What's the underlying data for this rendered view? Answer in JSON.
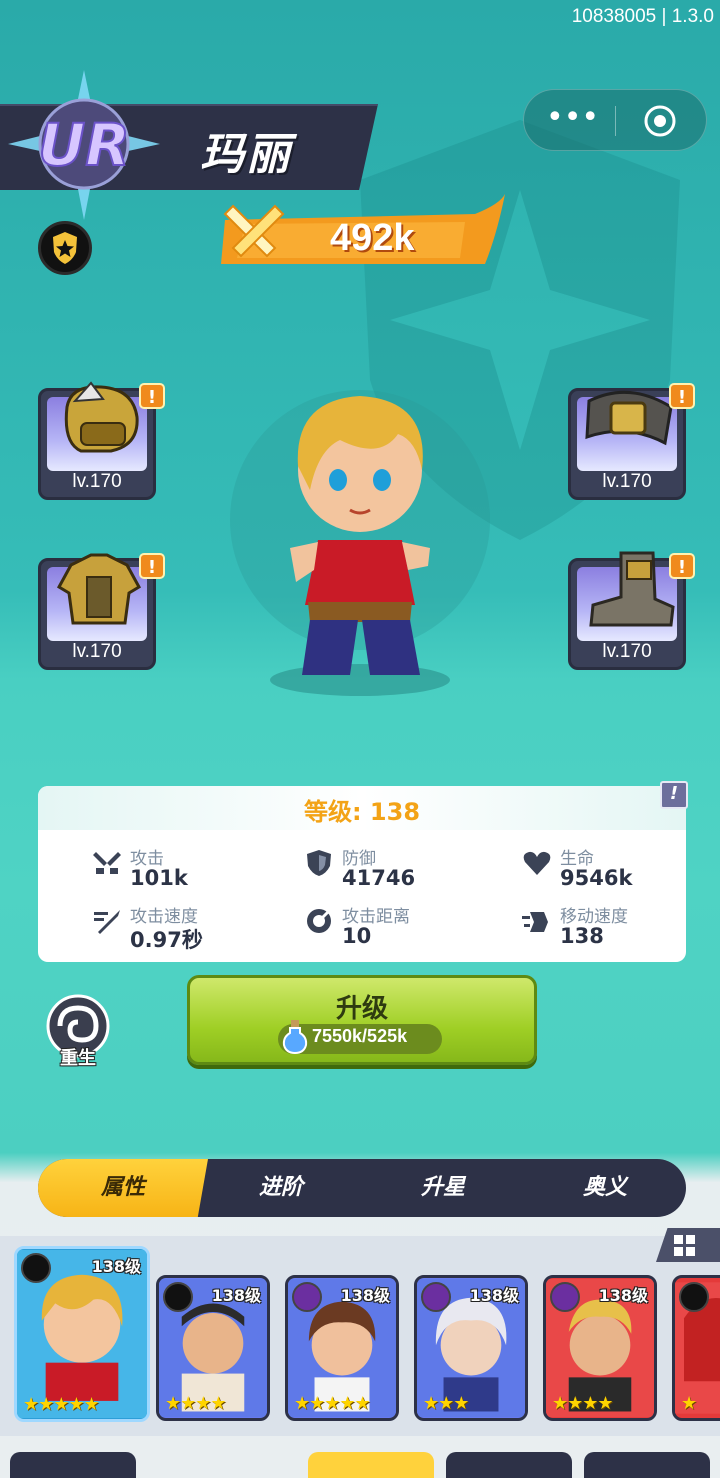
{
  "version": "10838005 | 1.3.0",
  "hero": {
    "rarity": "UR",
    "name": "玛丽",
    "power": "492k"
  },
  "equipment": [
    {
      "id": "gloves",
      "level": "lv.170"
    },
    {
      "id": "belt",
      "level": "lv.170"
    },
    {
      "id": "armor",
      "level": "lv.170"
    },
    {
      "id": "boots",
      "level": "lv.170"
    }
  ],
  "stats": {
    "level_label": "等级: 138",
    "items": [
      {
        "label": "攻击",
        "value": "101k",
        "icon": "attack-icon"
      },
      {
        "label": "防御",
        "value": "41746",
        "icon": "defense-icon"
      },
      {
        "label": "生命",
        "value": "9546k",
        "icon": "hp-icon"
      },
      {
        "label": "攻击速度",
        "value": "0.97秒",
        "icon": "attack-speed-icon"
      },
      {
        "label": "攻击距离",
        "value": "10",
        "icon": "attack-range-icon"
      },
      {
        "label": "移动速度",
        "value": "138",
        "icon": "move-speed-icon"
      }
    ]
  },
  "rebirth_label": "重生",
  "upgrade": {
    "label": "升级",
    "cost": "7550k/525k"
  },
  "tabs": [
    "属性",
    "进阶",
    "升星",
    "奥义"
  ],
  "active_tab": "属性",
  "roster": [
    {
      "level": "138级",
      "stars": "★★★★★",
      "selected": true
    },
    {
      "level": "138级",
      "stars": "★★★★"
    },
    {
      "level": "138级",
      "stars": "★★★★★"
    },
    {
      "level": "138级",
      "stars": "★★★"
    },
    {
      "level": "138级",
      "stars": "★★★★"
    },
    {
      "level": "",
      "stars": "★"
    }
  ],
  "colors": {
    "accent_orange": "#f3a316",
    "upgrade_green": "#9fcf25",
    "tab_yellow": "#ffd23c",
    "dark_panel": "#2d3147"
  }
}
